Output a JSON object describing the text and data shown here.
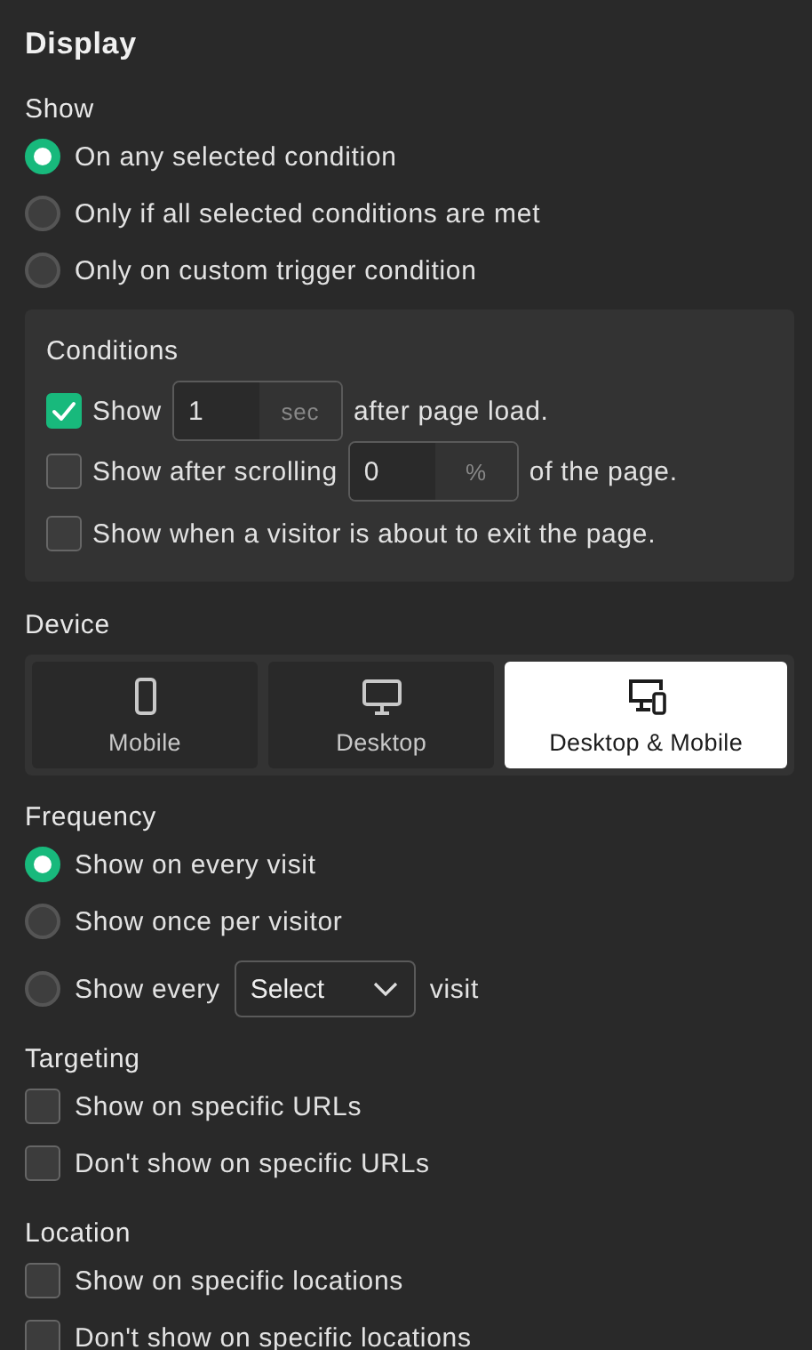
{
  "title": "Display",
  "show": {
    "label": "Show",
    "options": [
      {
        "label": "On any selected condition",
        "selected": true
      },
      {
        "label": "Only if all selected conditions are met",
        "selected": false
      },
      {
        "label": "Only on custom trigger condition",
        "selected": false
      }
    ]
  },
  "conditions": {
    "title": "Conditions",
    "items": [
      {
        "kind": "input",
        "checked": true,
        "prefix": "Show",
        "value": "1",
        "unit": "sec",
        "suffix": "after page load."
      },
      {
        "kind": "input",
        "checked": false,
        "prefix": "Show after scrolling",
        "value": "0",
        "unit": "%",
        "suffix": "of the page."
      },
      {
        "kind": "plain",
        "checked": false,
        "label": "Show when a visitor is about to exit the page."
      }
    ]
  },
  "device": {
    "label": "Device",
    "options": [
      {
        "kind": "mobile",
        "label": "Mobile",
        "selected": false
      },
      {
        "kind": "desktop",
        "label": "Desktop",
        "selected": false
      },
      {
        "kind": "both",
        "label": "Desktop & Mobile",
        "selected": true
      }
    ]
  },
  "frequency": {
    "label": "Frequency",
    "options": [
      {
        "kind": "plain",
        "label": "Show on every visit",
        "selected": true
      },
      {
        "kind": "plain",
        "label": "Show once per visitor",
        "selected": false
      },
      {
        "kind": "select",
        "prefix": "Show every",
        "select": "Select",
        "suffix": "visit",
        "selected": false
      }
    ]
  },
  "targeting": {
    "label": "Targeting",
    "items": [
      {
        "label": "Show on specific URLs",
        "checked": false
      },
      {
        "label": "Don't show on specific URLs",
        "checked": false
      }
    ]
  },
  "location": {
    "label": "Location",
    "items": [
      {
        "label": "Show on specific locations",
        "checked": false
      },
      {
        "label": "Don't show on specific locations",
        "checked": false
      }
    ]
  }
}
